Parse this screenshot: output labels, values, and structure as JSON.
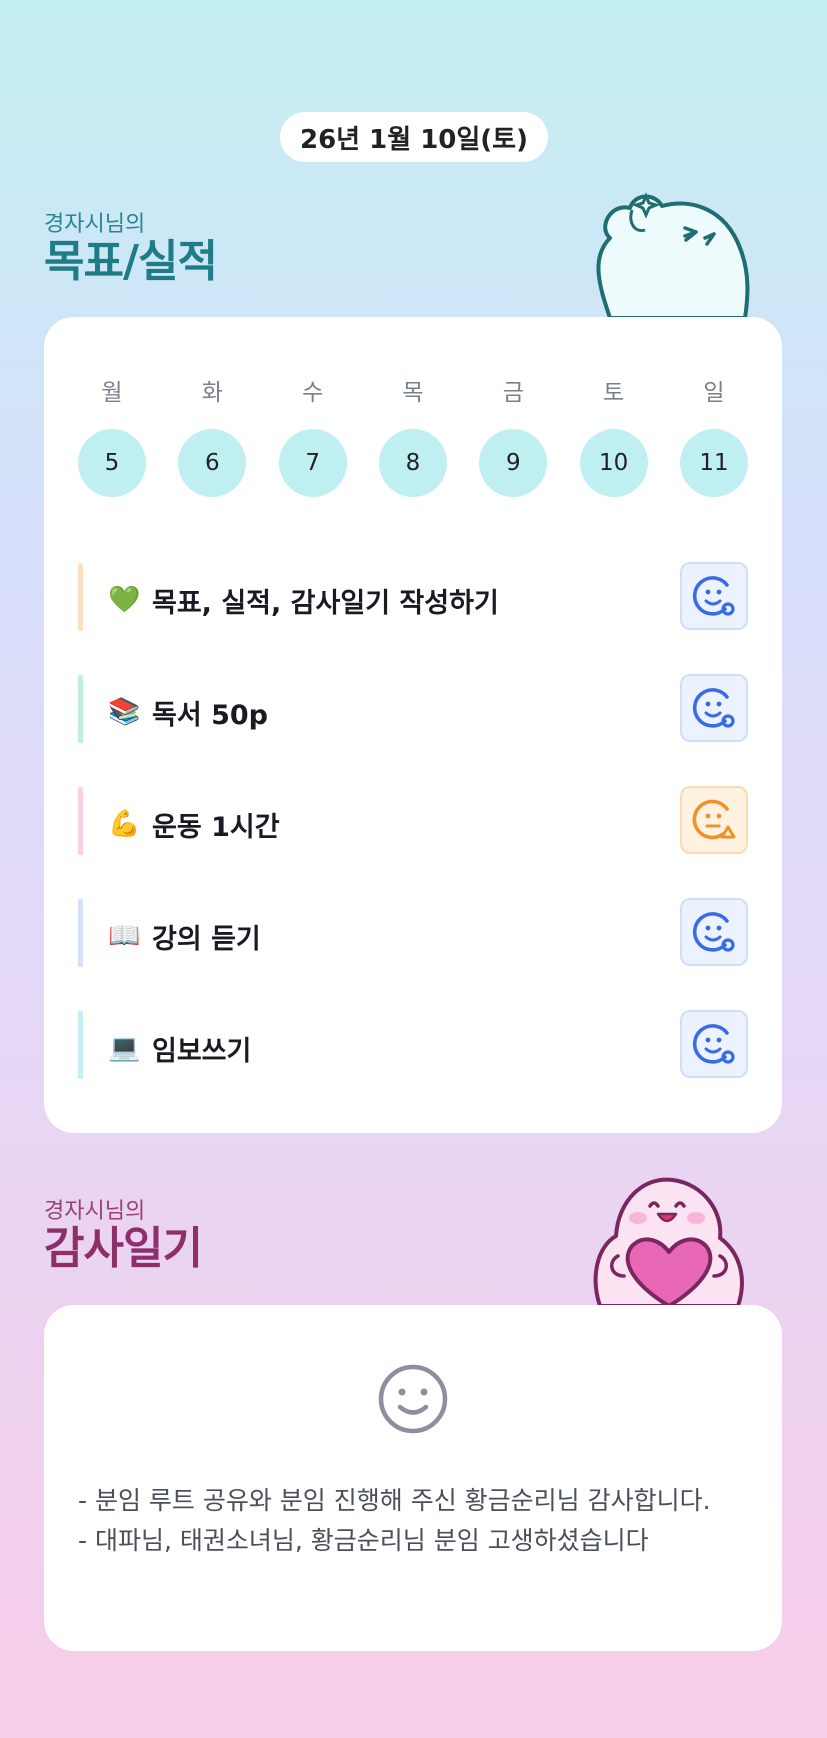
{
  "header": {
    "date": "26년 1월 10일(토)"
  },
  "goals_section": {
    "subtitle": "경자시님의",
    "title": "목표/실적"
  },
  "week": {
    "days": [
      {
        "weekday": "월",
        "date": "5"
      },
      {
        "weekday": "화",
        "date": "6"
      },
      {
        "weekday": "수",
        "date": "7"
      },
      {
        "weekday": "목",
        "date": "8"
      },
      {
        "weekday": "금",
        "date": "9"
      },
      {
        "weekday": "토",
        "date": "10"
      },
      {
        "weekday": "일",
        "date": "11"
      }
    ]
  },
  "goals": [
    {
      "emoji": "💚",
      "label": "목표, 실적, 감사일기 작성하기",
      "status": "achieved",
      "status_icon": "smile-circle-icon",
      "bar_color": "#fbe1c2"
    },
    {
      "emoji": "📚",
      "label": "독서 50p",
      "status": "achieved",
      "status_icon": "smile-circle-icon",
      "bar_color": "#c2efd8"
    },
    {
      "emoji": "💪",
      "label": "운동 1시간",
      "status": "partial",
      "status_icon": "meh-triangle-icon",
      "bar_color": "#fbd0e6"
    },
    {
      "emoji": "📖",
      "label": "강의 듣기",
      "status": "achieved",
      "status_icon": "smile-circle-icon",
      "bar_color": "#d5e0fa"
    },
    {
      "emoji": "💻",
      "label": "임보쓰기",
      "status": "achieved",
      "status_icon": "smile-circle-icon",
      "bar_color": "#c4eff4"
    }
  ],
  "diary_section": {
    "subtitle": "경자시님의",
    "title": "감사일기"
  },
  "diary": {
    "lines": [
      "- 분임 루트 공유와 분임 진행해 주신 황금순리님 감사합니다.",
      "- 대파님, 태권소녀님, 황금순리님 분임 고생하셨습니다"
    ]
  },
  "colors": {
    "achieved": "#3a6be6",
    "partial": "#f0922a",
    "teal_title": "#1f7c86",
    "plum_title": "#8e2f6c"
  }
}
